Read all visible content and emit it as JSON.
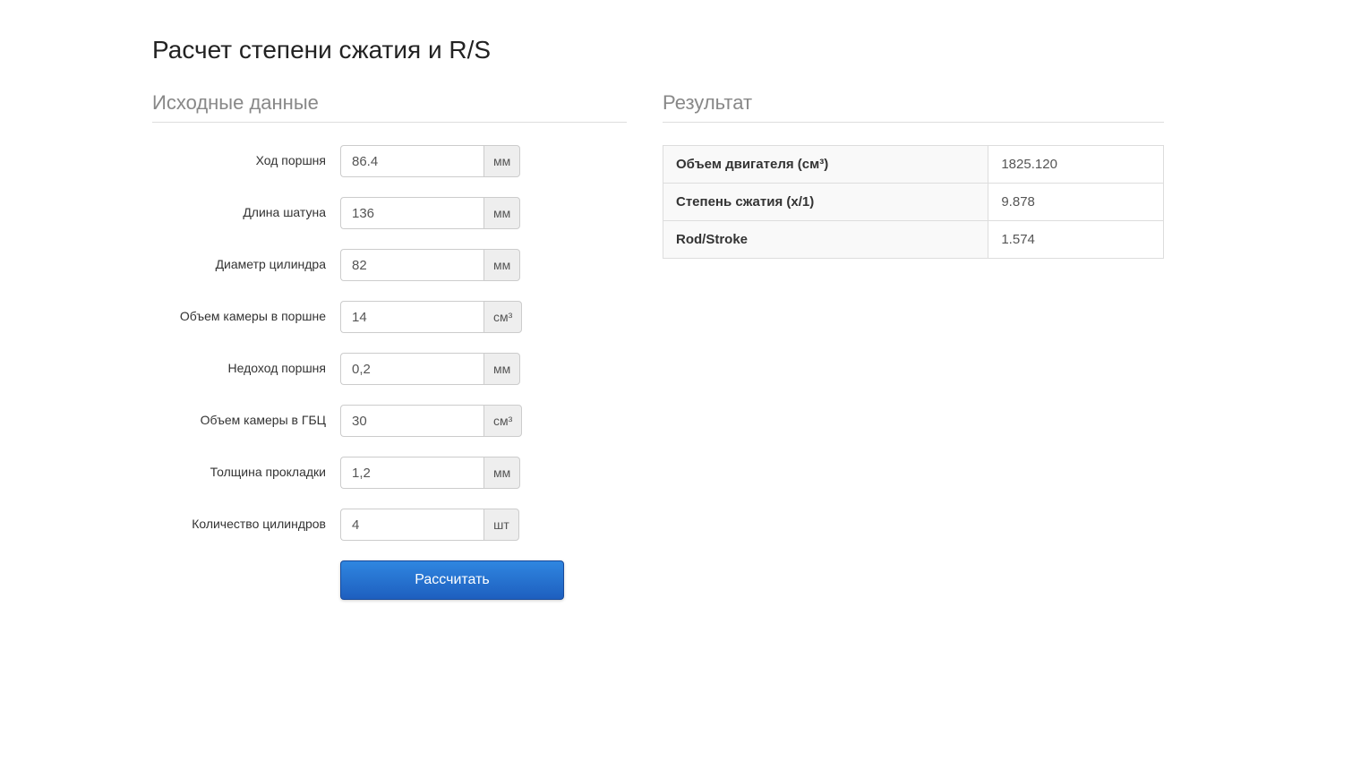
{
  "title": "Расчет степени сжатия и R/S",
  "sections": {
    "input_title": "Исходные данные",
    "result_title": "Результат"
  },
  "form": {
    "stroke": {
      "label": "Ход поршня",
      "value": "86.4",
      "unit": "мм"
    },
    "rod_length": {
      "label": "Длина шатуна",
      "value": "136",
      "unit": "мм"
    },
    "bore": {
      "label": "Диаметр цилиндра",
      "value": "82",
      "unit": "мм"
    },
    "piston_chamber": {
      "label": "Объем камеры в поршне",
      "value": "14",
      "unit": "см³"
    },
    "piston_underrun": {
      "label": "Недоход поршня",
      "value": "0,2",
      "unit": "мм"
    },
    "head_chamber": {
      "label": "Объем камеры в ГБЦ",
      "value": "30",
      "unit": "см³"
    },
    "gasket_thickness": {
      "label": "Толщина прокладки",
      "value": "1,2",
      "unit": "мм"
    },
    "cylinders": {
      "label": "Количество цилиндров",
      "value": "4",
      "unit": "шт"
    }
  },
  "button": {
    "calculate": "Рассчитать"
  },
  "results": {
    "displacement": {
      "label": "Объем двигателя (см³)",
      "value": "1825.120"
    },
    "compression": {
      "label": "Степень сжатия (x/1)",
      "value": "9.878"
    },
    "rod_stroke": {
      "label": "Rod/Stroke",
      "value": "1.574"
    }
  }
}
